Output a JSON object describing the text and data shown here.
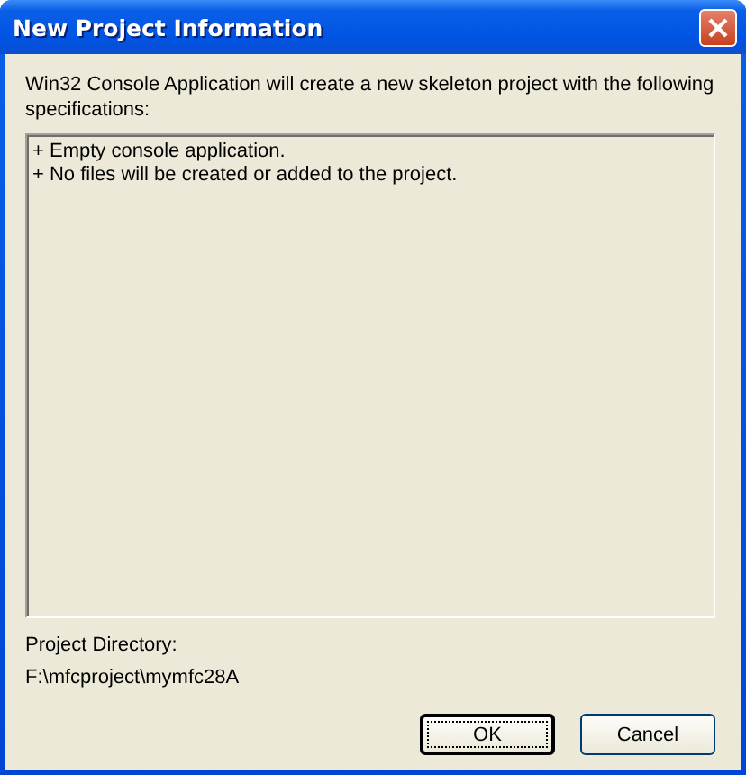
{
  "window": {
    "title": "New Project Information"
  },
  "intro": "Win32 Console Application will create a new skeleton project with the following specifications:",
  "specifications": [
    "+ Empty console application.",
    "+ No files will be created or added to the project."
  ],
  "project_directory": {
    "label": "Project Directory:",
    "value": "F:\\mfcproject\\mymfc28A"
  },
  "buttons": [
    {
      "label": "OK",
      "focused": true
    },
    {
      "label": "Cancel",
      "focused": false
    }
  ]
}
